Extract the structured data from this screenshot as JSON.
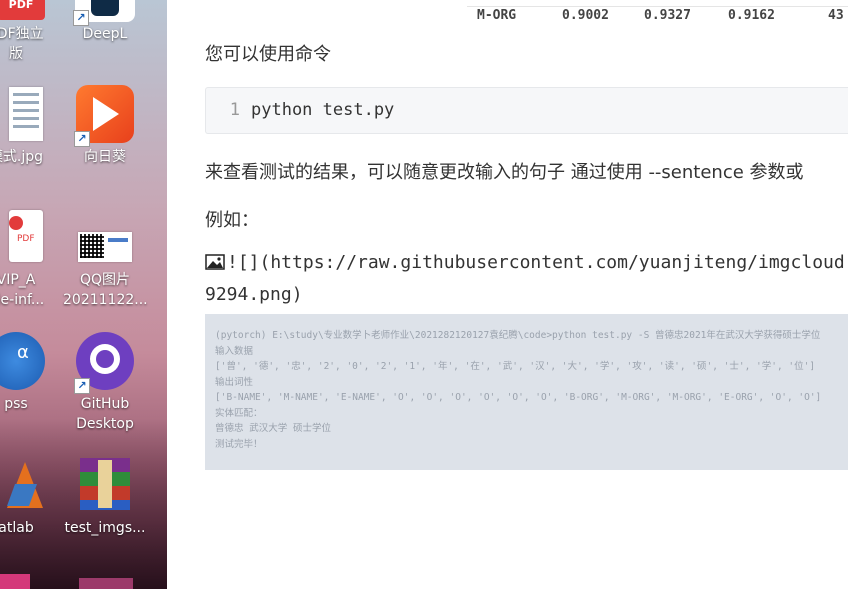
{
  "desktop": {
    "icons": [
      {
        "name": "pdf-app-icon",
        "label": "PDF独立",
        "label2": "版",
        "badge": "PDF"
      },
      {
        "name": "deepl-icon",
        "label": "DeepL"
      },
      {
        "name": "image-file-icon",
        "label": "模式.jpg"
      },
      {
        "name": "sunflower-icon",
        "label": "向日葵"
      },
      {
        "name": "pdf-file-icon",
        "label": "VIP_A",
        "label2": "ble-inf...",
        "badge": "PDF"
      },
      {
        "name": "qq-image-icon",
        "label": "QQ图片",
        "label2": "20211122..."
      },
      {
        "name": "spss-icon",
        "label": "pss"
      },
      {
        "name": "github-desktop-icon",
        "label": "GitHub",
        "label2": "Desktop"
      },
      {
        "name": "matlab-icon",
        "label": "atlab"
      },
      {
        "name": "winrar-icon",
        "label": "test_imgs..."
      }
    ]
  },
  "document": {
    "score_row": {
      "tag": "M-ORG",
      "precision": "0.9002",
      "recall": "0.9327",
      "f1": "0.9162",
      "support": "43"
    },
    "para_command": "您可以使用命令",
    "code": {
      "line_number": "1",
      "text": "python test.py"
    },
    "para_result": "来查看测试的结果，可以随意更改输入的句子 通过使用 --sentence 参数或",
    "para_example": "例如：",
    "image_markdown_line1": "![](https://raw.githubusercontent.com/yuanjiteng/imgcloud",
    "image_markdown_line2": "9294.png)",
    "console_lines": [
      "(pytorch) E:\\study\\专业数学卜老师作业\\2021282120127袁纪腾\\code>python test.py -S 曾德忠2021年在武汉大学获得硕士学位",
      "输入数据",
      "['曾', '德', '忠', '2', '0', '2', '1', '年', '在', '武', '汉', '大', '学', '攻', '读', '硕', '士', '学', '位']",
      "输出词性",
      "['B-NAME', 'M-NAME', 'E-NAME', 'O', 'O', 'O', 'O', 'O', 'O', 'B-ORG', 'M-ORG', 'M-ORG', 'E-ORG', 'O', 'O']",
      "实体匹配：",
      "曾德忠 武汉大学 硕士学位",
      "测试完毕！"
    ]
  },
  "colors": {
    "accent": "#1a5fb4",
    "code_bg": "#f6f7f9",
    "console_bg": "#dde2e9"
  }
}
